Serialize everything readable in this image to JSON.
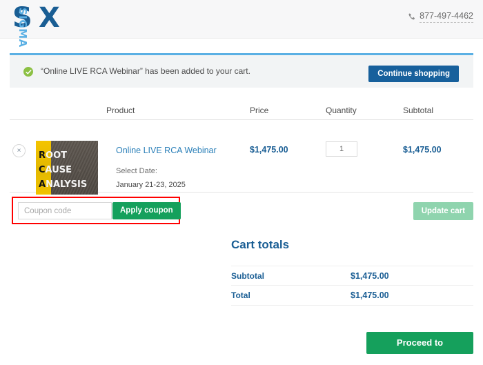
{
  "header": {
    "logo": {
      "s": "S",
      "sigma": "SIGMA",
      "x": "X",
      "color_dark": "#1a5e94",
      "color_light": "#5bb0e4"
    },
    "phone_icon": "phone-icon",
    "phone": "877-497-4462"
  },
  "notice": {
    "icon": "check-circle-icon",
    "message": "“Online LIVE RCA Webinar” has been added to your cart.",
    "continue_label": "Continue shopping",
    "accent_color": "#5bb0e4",
    "check_color": "#8cc044",
    "button_color": "#17609c"
  },
  "cart": {
    "columns": {
      "product": "Product",
      "price": "Price",
      "quantity": "Quantity",
      "subtotal": "Subtotal"
    },
    "items": [
      {
        "remove_icon": "close-icon",
        "remove_label": "×",
        "thumbnail": {
          "alt": "root-cause-analysis-thumbnail",
          "line1_cap": "R",
          "line1_rest": "OOT",
          "line2_cap": "C",
          "line2_rest": "AUSE",
          "line3_cap": "A",
          "line3_rest": "NALYSIS"
        },
        "name": "Online LIVE RCA Webinar",
        "meta_label": "Select Date:",
        "meta_value": "January 21-23, 2025",
        "price": "$1,475.00",
        "quantity": "1",
        "subtotal": "$1,475.00"
      }
    ]
  },
  "coupon": {
    "placeholder": "Coupon code",
    "value": "",
    "apply_label": "Apply coupon",
    "update_cart_label": "Update cart",
    "highlight_color": "#ff0000",
    "apply_color": "#15a05c",
    "update_color": "#8fd4ae"
  },
  "totals": {
    "title": "Cart totals",
    "rows": [
      {
        "label": "Subtotal",
        "value": "$1,475.00"
      },
      {
        "label": "Total",
        "value": "$1,475.00"
      }
    ],
    "checkout_label": "Proceed to checkout",
    "checkout_color": "#15a05c"
  }
}
